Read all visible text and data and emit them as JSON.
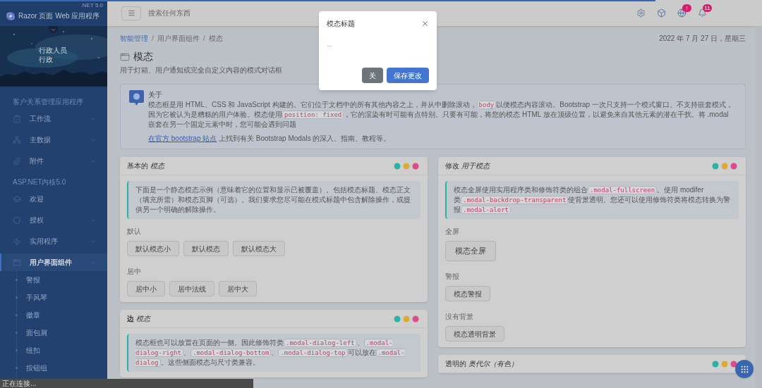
{
  "loading_bar": {
    "level": 0.86
  },
  "sidebar": {
    "brand": "Razor 页面 Web 应用程序",
    "brand_version": ".NET 5.0",
    "user": {
      "name": "行政人员",
      "role": "行政"
    },
    "sections": [
      {
        "title": "客户关系管理应用程序",
        "items": [
          {
            "label": "工作流",
            "has_children": true,
            "expanded": false,
            "selected": false
          },
          {
            "label": "主数据",
            "has_children": true,
            "expanded": false,
            "selected": false
          },
          {
            "label": "附件",
            "has_children": true,
            "expanded": false,
            "selected": false
          }
        ]
      },
      {
        "title": "ASP.NET内核5.0",
        "items": [
          {
            "label": "欢迎",
            "has_children": false,
            "expanded": false,
            "selected": false
          },
          {
            "label": "授权",
            "has_children": true,
            "expanded": false,
            "selected": false
          },
          {
            "label": "实用程序",
            "has_children": true,
            "expanded": false,
            "selected": false
          },
          {
            "label": "用户界面组件",
            "has_children": true,
            "expanded": true,
            "selected": true,
            "children": [
              {
                "label": "警报"
              },
              {
                "label": "手风琴"
              },
              {
                "label": "徽章"
              },
              {
                "label": "面包屑"
              },
              {
                "label": "纽扣"
              },
              {
                "label": "按钮组"
              }
            ]
          }
        ]
      }
    ]
  },
  "header": {
    "search": {
      "placeholder": "搜索任何东西"
    },
    "globe_badge": "!",
    "bell_badge": "11"
  },
  "breadcrumb": {
    "separator": "/",
    "items": [
      {
        "label": "智能管理",
        "link": true
      },
      {
        "label": "用户界面组件",
        "link": false
      },
      {
        "label": "模态",
        "link": false
      }
    ]
  },
  "date": "2022 年 7 月 27 日，星期三",
  "page": {
    "title": "模态",
    "subtitle": "用于灯箱、用户通知或完全自定义内容的模式对话框"
  },
  "about": {
    "title": "关于",
    "body": [
      {
        "text": "模态框是用 HTML、CSS 和 JavaScript 构建的。它们位于文档中的所有其他内容之上，并从中删除滚动，"
      },
      {
        "code": "body"
      },
      {
        "text": "以便模态内容滚动。Bootstrap 一次只支持一个模式窗口。不支持嵌套模式，因为它被认为是糟糕的用户体验。模态使用"
      },
      {
        "code": "position: fixed"
      },
      {
        "text": "，它的渲染有时可能有点特别。只要有可能，将您的模态 HTML 放在顶级位置，以避免来自其他元素的潜在干扰。将 .modal 嵌套在另一个固定元素中时，您可能会遇到问题"
      }
    ],
    "link": "在官方 bootstrap 站点",
    "link_rest": " 上找到有关 Bootstrap Modals 的深入、指南、教程等。"
  },
  "columns": [
    [
      {
        "title": "基本的 *模态*",
        "note": [
          {
            "text": "下面是一个静态模态示例（意味着它的位置和显示已被覆盖）。包括模态标题、模态正文（填充所需）和模态页脚（可选）。我们要求您尽可能在模式标题中包含解除操作，或提供另一个明确的解除操作。"
          }
        ],
        "groups": [
          {
            "label": "默认",
            "kind": "normal",
            "buttons": [
              "默认模态小",
              "默认模态",
              "默认模态大"
            ]
          },
          {
            "label": "居中",
            "kind": "normal",
            "buttons": [
              "居中小",
              "居中法线",
              "居中大"
            ]
          }
        ]
      },
      {
        "title": "**边** *模态*",
        "note": [
          {
            "text": "模态框也可以放置在页面的一侧。因此修饰符类"
          },
          {
            "code": ".modal-dialog-left"
          },
          {
            "text": "、"
          },
          {
            "code": ".modal-dialog-right"
          },
          {
            "text": "、"
          },
          {
            "code": ".modal-dialog-bottom"
          },
          {
            "text": "、"
          },
          {
            "code": ".modal-dialog-top"
          },
          {
            "text": "可以放在"
          },
          {
            "code": ".modal-dialog"
          },
          {
            "text": "。这些侧面模态与尺寸类兼容。"
          }
        ]
      }
    ],
    [
      {
        "title": "修改 *用于模态*",
        "note": [
          {
            "text": "模态全屏使用实用程序类和修饰符类的组合"
          },
          {
            "code": ".modal-fullscreen"
          },
          {
            "text": "。使用 modifer 类"
          },
          {
            "code": ".modal-backdrop-transparent"
          },
          {
            "text": "使背景透明。您还可以使用修饰符类将模态转换为警报"
          },
          {
            "code": ".modal-alert"
          }
        ],
        "groups": [
          {
            "label": "全屏",
            "kind": "large",
            "buttons": [
              "模态全屏"
            ]
          },
          {
            "label": "警报",
            "kind": "normal",
            "buttons": [
              "模态警报"
            ]
          },
          {
            "label": "没有背景",
            "kind": "normal",
            "buttons": [
              "模态透明背景"
            ]
          }
        ]
      },
      {
        "title": "透明的 *奥代尔（有色）*"
      }
    ]
  ],
  "modal": {
    "title": "模态标题",
    "body": "...",
    "buttons": [
      {
        "label": "关",
        "kind": "secondary"
      },
      {
        "label": "保存更改",
        "kind": "primary"
      }
    ]
  },
  "status_bar": "正在连接..."
}
